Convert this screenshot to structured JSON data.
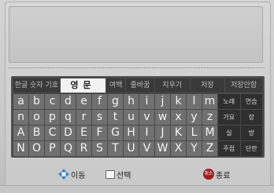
{
  "tabs": [
    {
      "label": "한글 숫자 기호",
      "active": false
    },
    {
      "label": "영문",
      "active": true
    },
    {
      "label": "여백",
      "active": false
    },
    {
      "label": "줄바꿈",
      "active": false
    },
    {
      "label": "지우기",
      "active": false
    },
    {
      "label": "저장",
      "active": false
    },
    {
      "label": "저장안함",
      "active": false
    }
  ],
  "keys": {
    "row1": [
      "a",
      "b",
      "c",
      "d",
      "e",
      "f",
      "g",
      "h",
      "i",
      "j",
      "k",
      "l",
      "m"
    ],
    "row2": [
      "n",
      "o",
      "p",
      "q",
      "r",
      "s",
      "t",
      "u",
      "v",
      "w",
      "x",
      "y",
      "z"
    ],
    "row3": [
      "A",
      "B",
      "C",
      "D",
      "E",
      "F",
      "G",
      "H",
      "I",
      "J",
      "K",
      "L",
      "M"
    ],
    "row4": [
      "N",
      "O",
      "P",
      "Q",
      "R",
      "S",
      "T",
      "U",
      "V",
      "W",
      "X",
      "Y",
      "Z"
    ]
  },
  "fn_keys": [
    [
      "노래",
      "연습"
    ],
    [
      "가요",
      "장"
    ],
    [
      "실",
      "방"
    ],
    [
      "주점",
      "단란"
    ]
  ],
  "help": {
    "move": "이동",
    "select": "선택",
    "cancel_badge": "취소",
    "exit": "종료"
  }
}
